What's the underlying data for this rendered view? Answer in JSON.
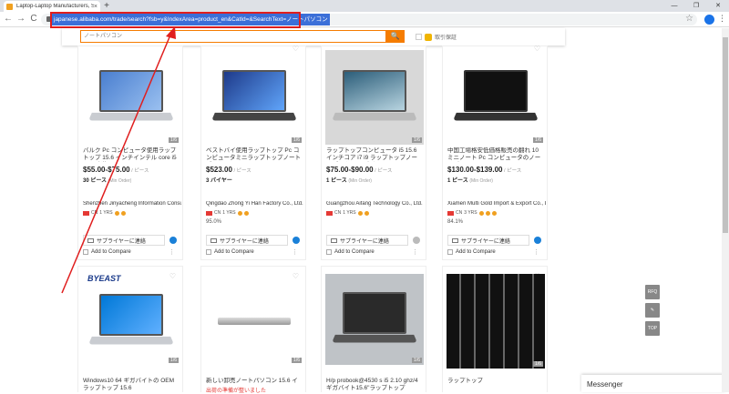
{
  "browser": {
    "tab_title": "Laptop-Laptop Manufacturers, S",
    "tab_close": "×",
    "new_tab": "+",
    "window_controls": [
      "—",
      "❐",
      "✕"
    ],
    "back": "←",
    "forward": "→",
    "reload": "C",
    "url": "japanese.alibaba.com/trade/search?fsb=y&IndexArea=product_en&CatId=&SearchText=ノートパソコン",
    "bookmark_star": "☆",
    "menu": "⋮"
  },
  "search": {
    "value": "ノートパソコン",
    "button": "🔍",
    "trade_assurance": "取引保証"
  },
  "products": [
    {
      "title": "バルク Pc コンピュータ使用ラップトップ 15.6 インチインテル core i5 i7 i9 改装ミニ",
      "page": "1/6",
      "price": "$55.00-$75.00",
      "unit": " / ピース",
      "moq": "30 ピース",
      "moq_note": "(Min Order)",
      "supplier": "Shenzhen Jinyacheng Information Consul...",
      "country": "CN",
      "years": "1 YRS",
      "rate": "",
      "contact": "サプライヤーに連絡",
      "compare": "Add to Compare"
    },
    {
      "title": "ベストバイ使用ラップトップ Pc コンピュータミニラップトップノートブック",
      "page": "1/6",
      "price": "$523.00",
      "unit": " / ピース",
      "moq": "3 バイヤー",
      "moq_note": "",
      "supplier": "Qingdao Zhong Yi Han Factory Co., Ltd.",
      "country": "CN",
      "years": "1 YRS",
      "rate": "95.0%",
      "contact": "サプライヤーに連絡",
      "compare": "Add to Compare"
    },
    {
      "title": "ラップトップコンピュータ i5 15.6 インチコア i7 i9 ラップトップノートブック 500 ギガ",
      "page": "1/6",
      "price": "$75.00-$90.00",
      "unit": " / ピース",
      "moq": "1 ピース",
      "moq_note": "(Min Order)",
      "supplier": "Guangzhou Aifang Technology Co., Ltd.",
      "country": "CN",
      "years": "1 YRS",
      "rate": "",
      "contact": "サプライヤーに連絡",
      "compare": "Add to Compare"
    },
    {
      "title": "中国工場格安低価格販売の翻れ 10 ミニノート Pc コンピュータのノートパソコン",
      "page": "1/6",
      "price": "$130.00-$139.00",
      "unit": " / ピース",
      "moq": "1 ピース",
      "moq_note": "(Min Order)",
      "supplier": "Xiamen Multi Gold Import & Export Co., Ltd.",
      "country": "CN",
      "years": "3 YRS",
      "rate": "84.1%",
      "contact": "サプライヤーに連絡",
      "compare": "Add to Compare"
    },
    {
      "title": "Windows10 64 ギガバイトの OEM ラップトップ 15.6",
      "page": "1/6",
      "brand": "BYEAST"
    },
    {
      "title": "新しい卸売ノートパソコン 15.6 インチ J3...",
      "page": "1/6",
      "tag": "出荷の準備が整いました"
    },
    {
      "title": "H/p probook@4530 s i5 2.10 ghz/4 ギガバイト15.6\"ラップトップ",
      "page": "1/6"
    },
    {
      "title": "ラップトップ",
      "page": "1/6"
    }
  ],
  "sidebar_buttons": [
    "RFQ",
    "✎",
    "TOP"
  ],
  "messenger": "Messenger",
  "colors": {
    "accent": "#f57c00",
    "highlight": "#e01e1e",
    "url_select": "#3b6fd8"
  }
}
